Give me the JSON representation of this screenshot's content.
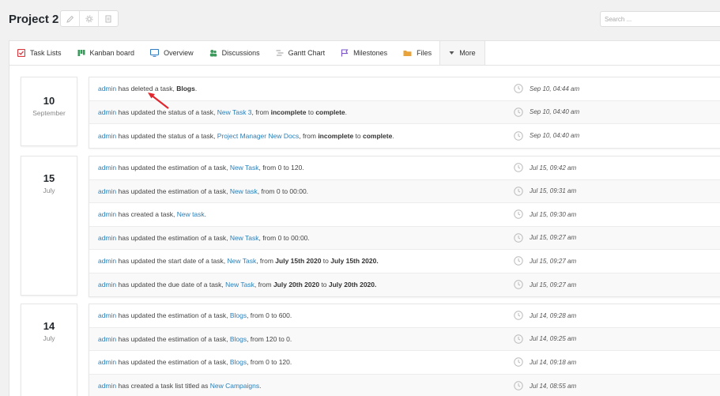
{
  "header": {
    "project_title": "Project 2",
    "search_placeholder": "Search ..."
  },
  "tabs": [
    {
      "label": "Task Lists",
      "icon": "task-list-icon",
      "color": "#d9363e"
    },
    {
      "label": "Kanban board",
      "icon": "kanban-icon",
      "color": "#3a9a5b"
    },
    {
      "label": "Overview",
      "icon": "monitor-icon",
      "color": "#2e7bbf"
    },
    {
      "label": "Discussions",
      "icon": "discussion-icon",
      "color": "#3a9a5b"
    },
    {
      "label": "Gantt Chart",
      "icon": "gantt-icon",
      "color": "#999999"
    },
    {
      "label": "Milestones",
      "icon": "flag-icon",
      "color": "#7a55c7"
    },
    {
      "label": "Files",
      "icon": "folder-icon",
      "color": "#e8a33a"
    },
    {
      "label": "More",
      "icon": "caret-down-icon",
      "color": "#555555"
    }
  ],
  "groups": [
    {
      "day": "10",
      "month": "September",
      "items": [
        {
          "actor": "admin",
          "parts": [
            [
              "t",
              " has deleted a task, "
            ],
            [
              "b",
              "Blogs"
            ],
            [
              "t",
              "."
            ]
          ],
          "time": "Sep 10, 04:44 am"
        },
        {
          "actor": "admin",
          "parts": [
            [
              "t",
              " has updated the status of a task, "
            ],
            [
              "a",
              "New Task 3"
            ],
            [
              "t",
              ", from "
            ],
            [
              "b",
              "incomplete"
            ],
            [
              "t",
              " to "
            ],
            [
              "b",
              "complete"
            ],
            [
              "t",
              "."
            ]
          ],
          "time": "Sep 10, 04:40 am"
        },
        {
          "actor": "admin",
          "parts": [
            [
              "t",
              " has updated the status of a task, "
            ],
            [
              "a",
              "Project Manager New Docs"
            ],
            [
              "t",
              ", from "
            ],
            [
              "b",
              "incomplete"
            ],
            [
              "t",
              " to "
            ],
            [
              "b",
              "complete"
            ],
            [
              "t",
              "."
            ]
          ],
          "time": "Sep 10, 04:40 am"
        }
      ]
    },
    {
      "day": "15",
      "month": "July",
      "items": [
        {
          "actor": "admin",
          "parts": [
            [
              "t",
              " has updated the estimation of a task, "
            ],
            [
              "a",
              "New Task"
            ],
            [
              "t",
              ", from 0 to 120."
            ]
          ],
          "time": "Jul 15, 09:42 am"
        },
        {
          "actor": "admin",
          "parts": [
            [
              "t",
              " has updated the estimation of a task, "
            ],
            [
              "a",
              "New task"
            ],
            [
              "t",
              ", from 0 to 00:00."
            ]
          ],
          "time": "Jul 15, 09:31 am"
        },
        {
          "actor": "admin",
          "parts": [
            [
              "t",
              " has created a task, "
            ],
            [
              "a",
              "New task"
            ],
            [
              "t",
              "."
            ]
          ],
          "time": "Jul 15, 09:30 am"
        },
        {
          "actor": "admin",
          "parts": [
            [
              "t",
              " has updated the estimation of a task, "
            ],
            [
              "a",
              "New Task"
            ],
            [
              "t",
              ", from 0 to 00:00."
            ]
          ],
          "time": "Jul 15, 09:27 am"
        },
        {
          "actor": "admin",
          "parts": [
            [
              "t",
              " has updated the start date of a task, "
            ],
            [
              "a",
              "New Task"
            ],
            [
              "t",
              ", from "
            ],
            [
              "b",
              "July 15th 2020"
            ],
            [
              "t",
              " to "
            ],
            [
              "b",
              "July 15th 2020."
            ]
          ],
          "time": "Jul 15, 09:27 am"
        },
        {
          "actor": "admin",
          "parts": [
            [
              "t",
              " has updated the due date of a task, "
            ],
            [
              "a",
              "New Task"
            ],
            [
              "t",
              ", from "
            ],
            [
              "b",
              "July 20th 2020"
            ],
            [
              "t",
              " to "
            ],
            [
              "b",
              "July 20th 2020."
            ]
          ],
          "time": "Jul 15, 09:27 am"
        }
      ]
    },
    {
      "day": "14",
      "month": "July",
      "items": [
        {
          "actor": "admin",
          "parts": [
            [
              "t",
              " has updated the estimation of a task, "
            ],
            [
              "a",
              "Blogs"
            ],
            [
              "t",
              ", from 0 to 600."
            ]
          ],
          "time": "Jul 14, 09:28 am"
        },
        {
          "actor": "admin",
          "parts": [
            [
              "t",
              " has updated the estimation of a task, "
            ],
            [
              "a",
              "Blogs"
            ],
            [
              "t",
              ", from 120 to 0."
            ]
          ],
          "time": "Jul 14, 09:25 am"
        },
        {
          "actor": "admin",
          "parts": [
            [
              "t",
              " has updated the estimation of a task, "
            ],
            [
              "a",
              "Blogs"
            ],
            [
              "t",
              ", from 0 to 120."
            ]
          ],
          "time": "Jul 14, 09:18 am"
        },
        {
          "actor": "admin",
          "parts": [
            [
              "t",
              " has created a task list titled as "
            ],
            [
              "a",
              "New Campaigns"
            ],
            [
              "t",
              "."
            ]
          ],
          "time": "Jul 14, 08:55 am"
        }
      ]
    }
  ],
  "colors": {
    "link": "#2a7fb8",
    "annotation_arrow": "#e0262e"
  }
}
